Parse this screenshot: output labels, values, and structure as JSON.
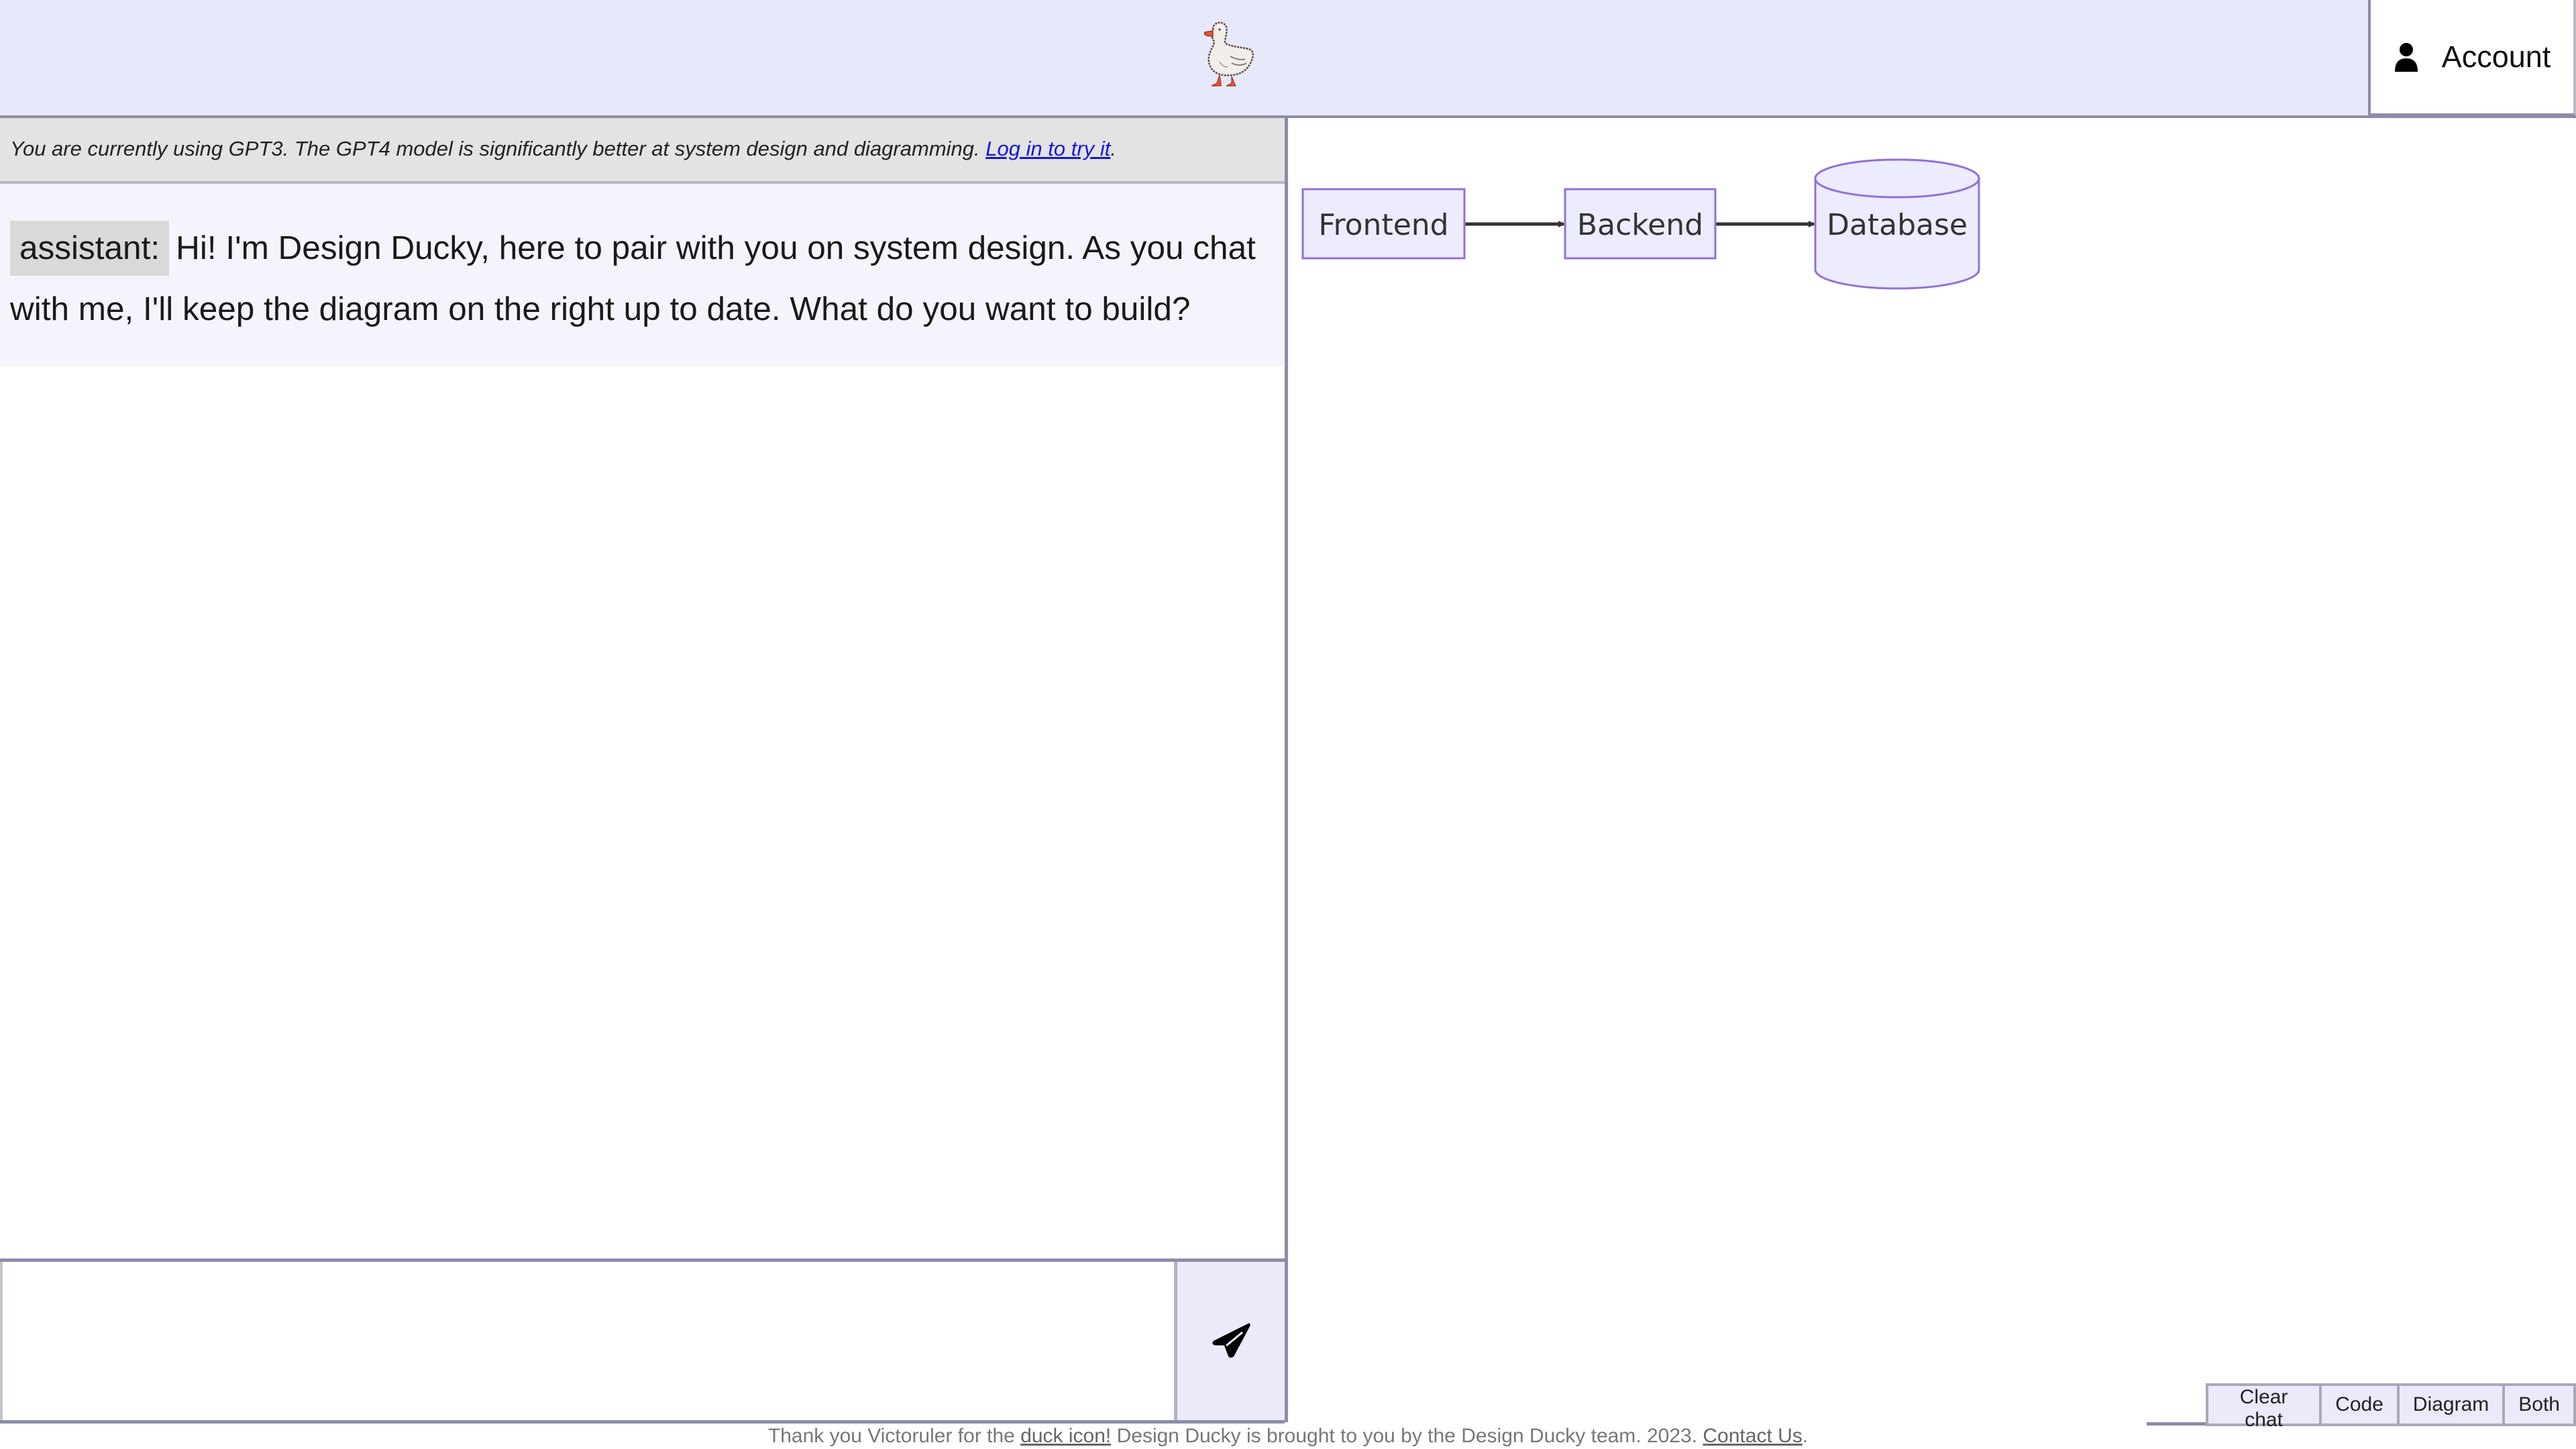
{
  "header": {
    "logo_icon": "duck-icon",
    "account_button": {
      "label": "Account",
      "icon": "user-icon"
    }
  },
  "notice": {
    "text": "You are currently using GPT3. The GPT4 model is significantly better at system design and diagramming. ",
    "link_label": "Log in to try it",
    "suffix": "."
  },
  "chat": {
    "messages": [
      {
        "role": "assistant:",
        "text": "Hi! I'm Design Ducky, here to pair with you on system design. As you chat with me, I'll keep the diagram on the right up to date. What do you want to build?"
      }
    ],
    "input": {
      "value": "",
      "placeholder": ""
    },
    "send_button": {
      "icon": "paper-plane-icon"
    }
  },
  "diagram": {
    "type": "flowchart",
    "direction": "left-to-right",
    "nodes": [
      {
        "id": "frontend",
        "label": "Frontend",
        "shape": "rectangle"
      },
      {
        "id": "backend",
        "label": "Backend",
        "shape": "rectangle"
      },
      {
        "id": "database",
        "label": "Database",
        "shape": "cylinder"
      }
    ],
    "edges": [
      {
        "from": "frontend",
        "to": "backend"
      },
      {
        "from": "backend",
        "to": "database"
      }
    ],
    "colors": {
      "node_fill": "#ececfe",
      "node_stroke": "#9370db",
      "edge": "#333333"
    }
  },
  "view_buttons": [
    {
      "label": "Clear chat"
    },
    {
      "label": "Code"
    },
    {
      "label": "Diagram"
    },
    {
      "label": "Both"
    }
  ],
  "footer": {
    "prefix": "Thank you Victoruler for the ",
    "duck_link": "duck icon!",
    "middle": " Design Ducky is brought to you by the Design Ducky team. 2023. ",
    "contact_link": "Contact Us",
    "suffix": "."
  },
  "colors": {
    "header_bg": "#e8e8fb",
    "border": "#8c8caa",
    "notice_bg": "#e3e3e3",
    "message_bg": "#f4f4fd",
    "role_label_bg": "#d9d9d9",
    "link": "#1515dd"
  }
}
